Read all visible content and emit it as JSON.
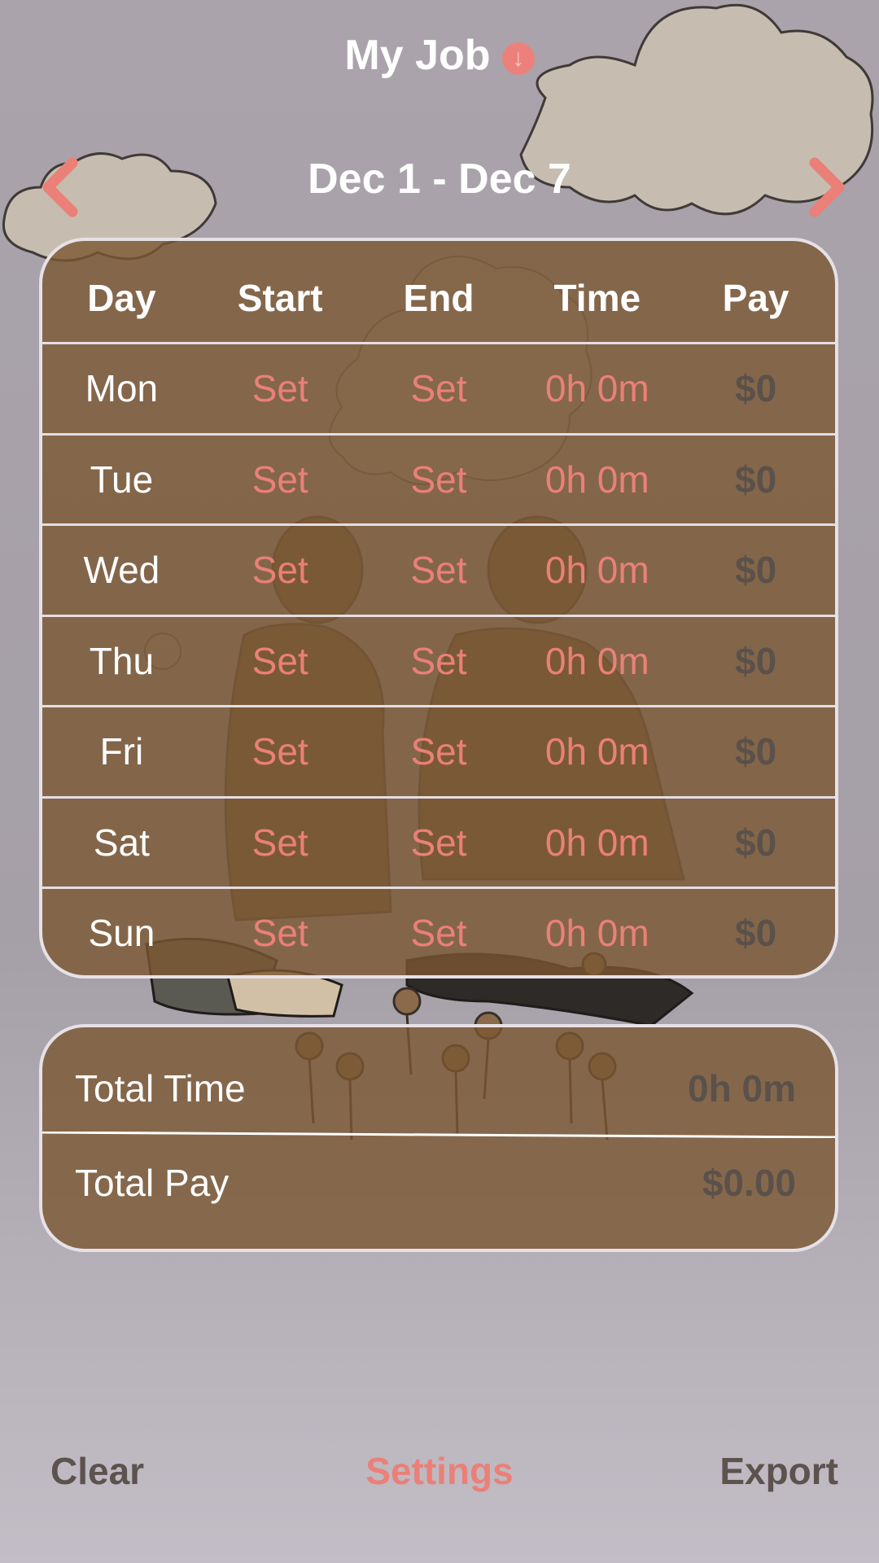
{
  "header": {
    "title": "My Job",
    "download_icon": "arrow-down-circle-icon"
  },
  "week": {
    "label": "Dec 1 - Dec 7",
    "prev_icon": "chevron-left-icon",
    "next_icon": "chevron-right-icon"
  },
  "schedule": {
    "columns": [
      "Day",
      "Start",
      "End",
      "Time",
      "Pay"
    ],
    "rows": [
      {
        "day": "Mon",
        "start": "Set",
        "end": "Set",
        "time": "0h 0m",
        "pay": "$0"
      },
      {
        "day": "Tue",
        "start": "Set",
        "end": "Set",
        "time": "0h 0m",
        "pay": "$0"
      },
      {
        "day": "Wed",
        "start": "Set",
        "end": "Set",
        "time": "0h 0m",
        "pay": "$0"
      },
      {
        "day": "Thu",
        "start": "Set",
        "end": "Set",
        "time": "0h 0m",
        "pay": "$0"
      },
      {
        "day": "Fri",
        "start": "Set",
        "end": "Set",
        "time": "0h 0m",
        "pay": "$0"
      },
      {
        "day": "Sat",
        "start": "Set",
        "end": "Set",
        "time": "0h 0m",
        "pay": "$0"
      },
      {
        "day": "Sun",
        "start": "Set",
        "end": "Set",
        "time": "0h 0m",
        "pay": "$0"
      }
    ]
  },
  "totals": {
    "time_label": "Total Time",
    "time_value": "0h 0m",
    "pay_label": "Total Pay",
    "pay_value": "$0.00"
  },
  "bottom_bar": {
    "clear": "Clear",
    "settings": "Settings",
    "export": "Export"
  },
  "colors": {
    "accent": "#ea8077",
    "panel": "#7a5832",
    "muted_value": "#5b514a",
    "background": "#aaa3ab"
  }
}
